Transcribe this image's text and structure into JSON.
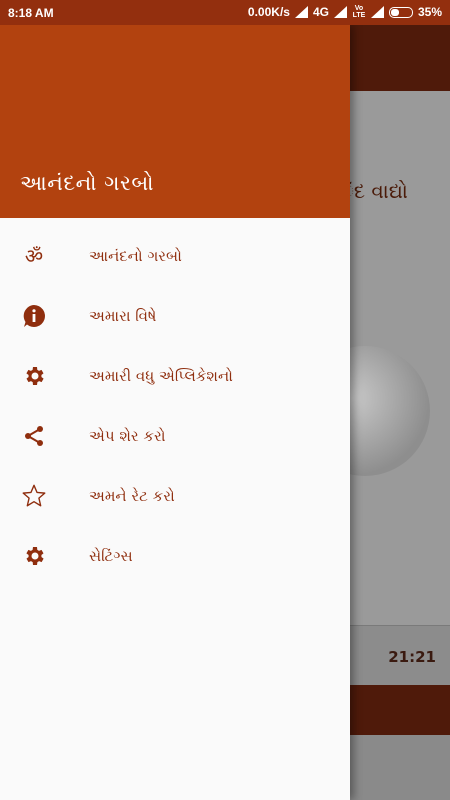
{
  "status_bar": {
    "time": "8:18 AM",
    "network_speed": "0.00K/s",
    "network_type": "4G",
    "volte_label": "Vo LTE",
    "battery": "35%",
    "battery_level": 0.35
  },
  "background": {
    "title_fragment": "ંદ વાદ્યો",
    "player_time": "21:21"
  },
  "drawer": {
    "title": "આનંદનો ગરબો",
    "items": [
      {
        "label": "આનંદનો ગરબો",
        "icon": "om-icon"
      },
      {
        "label": "અમારા વિષે",
        "icon": "info-icon"
      },
      {
        "label": "અમારી વધુ એપ્લિકેશનો",
        "icon": "gear-icon"
      },
      {
        "label": "એપ શેર કરો",
        "icon": "share-icon"
      },
      {
        "label": "અમને રેટ કરો",
        "icon": "star-icon"
      },
      {
        "label": "સેટિંગ્સ",
        "icon": "gear-icon"
      }
    ]
  },
  "colors": {
    "status_bar": "#932f0e",
    "drawer_header": "#b2420f",
    "accent": "#8f2e0e"
  }
}
